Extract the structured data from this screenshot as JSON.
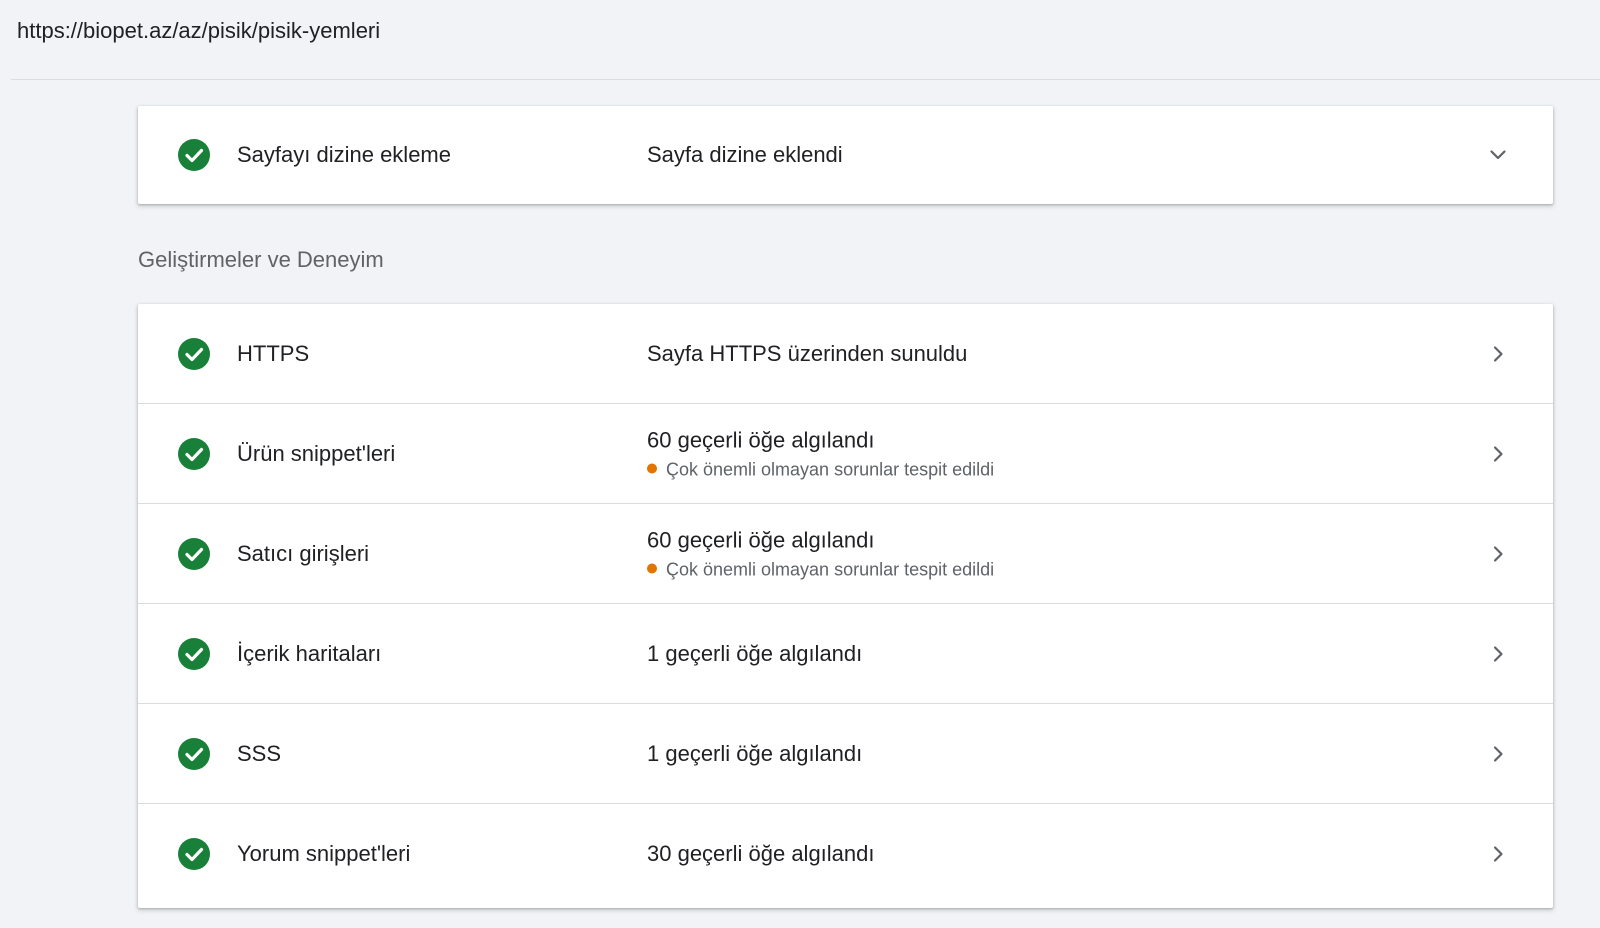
{
  "url": "https://biopet.az/az/pisik/pisik-yemleri",
  "colors": {
    "success_green": "#188038",
    "warning_orange": "#e37400",
    "divider": "#dadce0",
    "background": "#f1f3f6"
  },
  "index_card": {
    "label": "Sayfayı dizine ekleme",
    "status": "Sayfa dizine eklendi",
    "status_icon": "check-circle-icon",
    "action_icon": "chevron-down-icon"
  },
  "section_title": "Geliştirmeler ve Deneyim",
  "enhancements": [
    {
      "label": "HTTPS",
      "status": "Sayfa HTTPS üzerinden sunuldu",
      "warning": null,
      "status_icon": "check-circle-icon",
      "action_icon": "chevron-right-icon"
    },
    {
      "label": "Ürün snippet'leri",
      "status": "60 geçerli öğe algılandı",
      "warning": "Çok önemli olmayan sorunlar tespit edildi",
      "status_icon": "check-circle-icon",
      "action_icon": "chevron-right-icon"
    },
    {
      "label": "Satıcı girişleri",
      "status": "60 geçerli öğe algılandı",
      "warning": "Çok önemli olmayan sorunlar tespit edildi",
      "status_icon": "check-circle-icon",
      "action_icon": "chevron-right-icon"
    },
    {
      "label": "İçerik haritaları",
      "status": "1 geçerli öğe algılandı",
      "warning": null,
      "status_icon": "check-circle-icon",
      "action_icon": "chevron-right-icon"
    },
    {
      "label": "SSS",
      "status": "1 geçerli öğe algılandı",
      "warning": null,
      "status_icon": "check-circle-icon",
      "action_icon": "chevron-right-icon"
    },
    {
      "label": "Yorum snippet'leri",
      "status": "30 geçerli öğe algılandı",
      "warning": null,
      "status_icon": "check-circle-icon",
      "action_icon": "chevron-right-icon"
    }
  ]
}
